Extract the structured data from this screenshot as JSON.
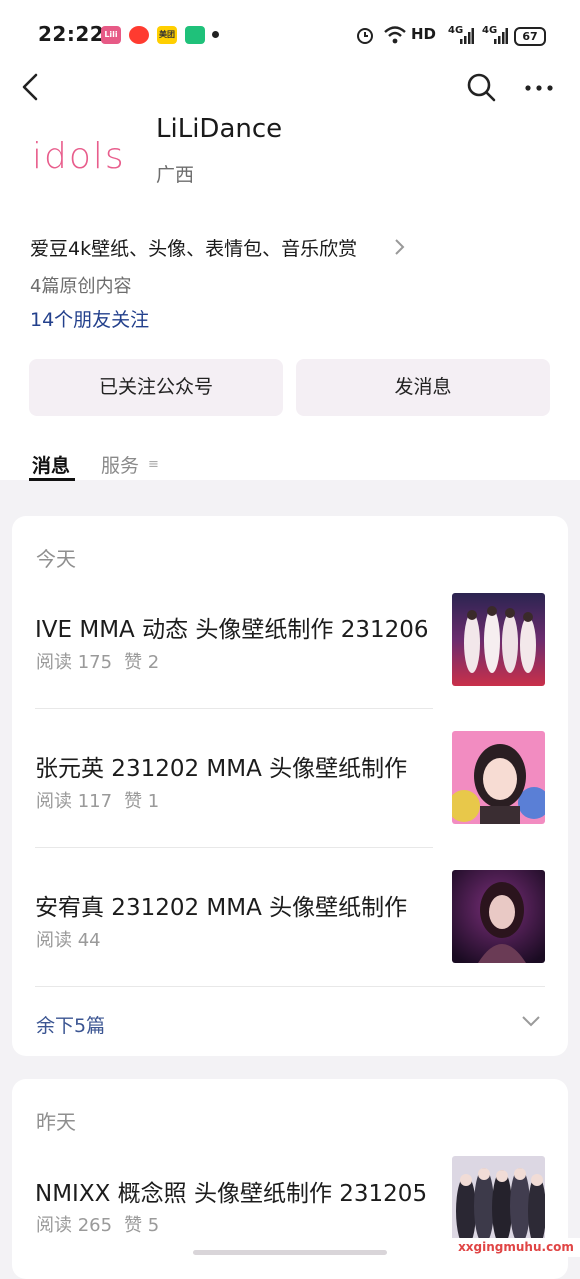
{
  "status_bar": {
    "time": "22:22",
    "apps": [
      {
        "icon": "lili-app-icon",
        "color": "#e75a86",
        "text": "Lili"
      },
      {
        "icon": "red-video-app-icon",
        "color": "#ff3b30",
        "text": ""
      },
      {
        "icon": "meituan-app-icon",
        "color": "#ffcf00",
        "text": "美团"
      },
      {
        "icon": "green-app-icon",
        "color": "#1fc17a",
        "text": ""
      }
    ],
    "hd": "HD",
    "net1": "4G",
    "net2": "4G",
    "battery": "67"
  },
  "nav": {
    "back_icon": "back-arrow-icon",
    "search_icon": "search-icon",
    "more_icon": "more-dots-icon"
  },
  "profile": {
    "logo_text": "idols",
    "name": "LiLiDance",
    "region": "广西",
    "description": "爱豆4k壁纸、头像、表情包、音乐欣赏",
    "originals": "4篇原创内容",
    "friends_following": "14个朋友关注"
  },
  "actions": {
    "followed": "已关注公众号",
    "message": "发消息"
  },
  "tabs": {
    "messages": "消息",
    "services": "服务",
    "services_icon": "≡"
  },
  "groups": [
    {
      "day": "今天",
      "articles": [
        {
          "title": "IVE MMA 动态 头像壁纸制作 231206",
          "reads": "阅读 175",
          "likes": "赞 2"
        },
        {
          "title": "张元英 231202 MMA 头像壁纸制作",
          "reads": "阅读 117",
          "likes": "赞 1"
        },
        {
          "title": "安宥真 231202 MMA 头像壁纸制作",
          "reads": "阅读 44",
          "likes": ""
        }
      ],
      "remaining": "余下5篇"
    },
    {
      "day": "昨天",
      "articles": [
        {
          "title": "NMIXX 概念照 头像壁纸制作 231205",
          "reads": "阅读 265",
          "likes": "赞 5"
        }
      ]
    }
  ],
  "watermark": "xxgingmuhu.com",
  "colors": {
    "link": "#23408c",
    "button_bg": "#f4eff4",
    "page_bg": "#f3f2f5",
    "logo_pink": "#e85d8c"
  }
}
